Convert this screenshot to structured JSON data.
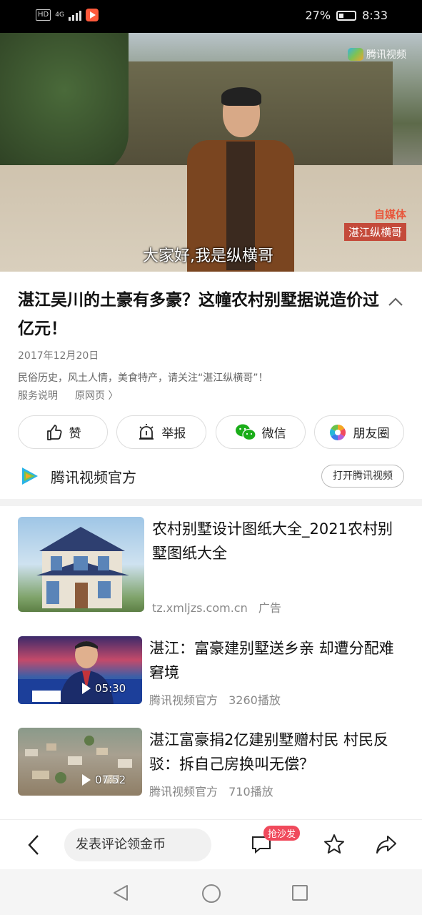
{
  "status_bar": {
    "network": "HD",
    "signal": "4G",
    "battery": "27%",
    "time": "8:33"
  },
  "video": {
    "logo_text": "腾讯视频",
    "badge_top": "自媒体",
    "badge_bottom": "湛江纵横哥",
    "subtitle": "大家好,我是纵横哥"
  },
  "article": {
    "title": "湛江吴川的土豪有多豪？这幢农村别墅据说造价过亿元！",
    "date": "2017年12月20日",
    "description": "民俗历史，风土人情，美食特产，请关注“湛江纵横哥”！",
    "service_link": "服务说明",
    "original_link": "原网页 〉"
  },
  "actions": [
    {
      "label": "赞",
      "icon": "thumbs-up-icon"
    },
    {
      "label": "举报",
      "icon": "report-icon"
    },
    {
      "label": "微信",
      "icon": "wechat-icon"
    },
    {
      "label": "朋友圈",
      "icon": "moments-icon"
    }
  ],
  "source": {
    "name": "腾讯视频官方",
    "open_button": "打开腾讯视频"
  },
  "feed": [
    {
      "title": "农村别墅设计图纸大全_2021农村别墅图纸大全",
      "domain": "tz.xmljzs.com.cn",
      "tag": "广告"
    },
    {
      "title": "湛江：富豪建别墅送乡亲 却遭分配难窘境",
      "author": "腾讯视频官方",
      "plays": "3260播放",
      "duration": "05:30"
    },
    {
      "title": "湛江富豪捐2亿建别墅赠村民 村民反驳：拆自己房换叫无偿？",
      "author": "腾讯视频官方",
      "plays": "710播放",
      "duration": "07:52"
    }
  ],
  "bottom_bar": {
    "comment_placeholder": "发表评论领金币",
    "sofa_badge": "抢沙发"
  },
  "colors": {
    "accent_red": "#f04a5c",
    "wechat_green": "#1aad19"
  }
}
